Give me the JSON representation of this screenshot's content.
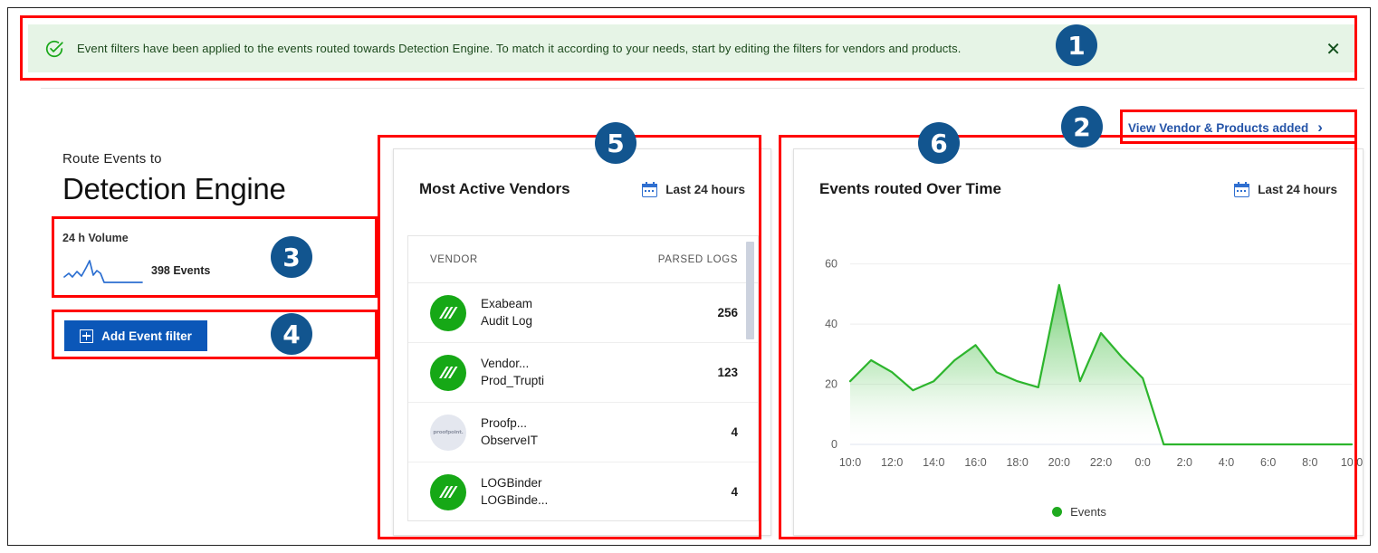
{
  "banner": {
    "icon": "check-circle-icon",
    "message": "Event filters have been applied to the events routed towards Detection Engine. To match it according to your needs, start by editing the filters for vendors and products.",
    "close_label": "✕",
    "background": "#e6f4e6",
    "icon_color": "#1aa81a"
  },
  "view_vendor_link": {
    "label": "View Vendor & Products added",
    "chevron": "›",
    "color": "#2554a8"
  },
  "left": {
    "eyebrow": "Route Events to",
    "title": "Detection Engine",
    "volume_label": "24 h Volume",
    "volume_count": "398 Events",
    "sparkline_color": "#2c6fd1",
    "add_filter_button": "Add Event filter",
    "add_filter_color": "#0b57b8"
  },
  "vendors_card": {
    "title": "Most Active Vendors",
    "range": "Last 24 hours",
    "range_icon": "calendar-icon",
    "columns": [
      "VENDOR",
      "PARSED LOGS"
    ],
    "rows": [
      {
        "vendor": "Exabeam",
        "product": "Audit Log",
        "logs": "256",
        "avatar": "exabeam-logo",
        "avatar_style": "green"
      },
      {
        "vendor": "Vendor...",
        "product": "Prod_Trupti",
        "logs": "123",
        "avatar": "exabeam-logo",
        "avatar_style": "green"
      },
      {
        "vendor": "Proofp...",
        "product": "ObserveIT",
        "logs": "4",
        "avatar": "proofpoint-logo",
        "avatar_style": "grey"
      },
      {
        "vendor": "LOGBinder",
        "product": "LOGBinde...",
        "logs": "4",
        "avatar": "exabeam-logo",
        "avatar_style": "green"
      }
    ]
  },
  "chart_card": {
    "title": "Events routed Over Time",
    "range": "Last 24 hours",
    "range_icon": "calendar-icon"
  },
  "chart_data": {
    "type": "area",
    "title": "Events routed Over Time",
    "xlabel": "",
    "ylabel": "",
    "ylim": [
      0,
      65
    ],
    "yticks": [
      0,
      20,
      40,
      60
    ],
    "grid": true,
    "legend_position": "bottom",
    "legend": [
      "Events"
    ],
    "series_color": "#2db52d",
    "x": [
      "10:0",
      "11:0",
      "12:0",
      "13:0",
      "14:0",
      "15:0",
      "16:0",
      "17:0",
      "18:0",
      "19:0",
      "20:0",
      "21:0",
      "22:0",
      "23:0",
      "0:0",
      "1:0",
      "2:0",
      "3:0",
      "4:0",
      "5:0",
      "6:0",
      "7:0",
      "8:0",
      "9:0",
      "10:0"
    ],
    "xticks": [
      "10:0",
      "12:0",
      "14:0",
      "16:0",
      "18:0",
      "20:0",
      "22:0",
      "0:0",
      "2:0",
      "4:0",
      "6:0",
      "8:0",
      "10:0"
    ],
    "series": [
      {
        "name": "Events",
        "values": [
          21,
          28,
          24,
          18,
          21,
          28,
          33,
          24,
          21,
          19,
          53,
          21,
          37,
          29,
          22,
          0,
          0,
          0,
          0,
          0,
          0,
          0,
          0,
          0,
          0
        ]
      }
    ]
  },
  "annotations": [
    {
      "number": "1"
    },
    {
      "number": "2"
    },
    {
      "number": "3"
    },
    {
      "number": "4"
    },
    {
      "number": "5"
    },
    {
      "number": "6"
    }
  ]
}
